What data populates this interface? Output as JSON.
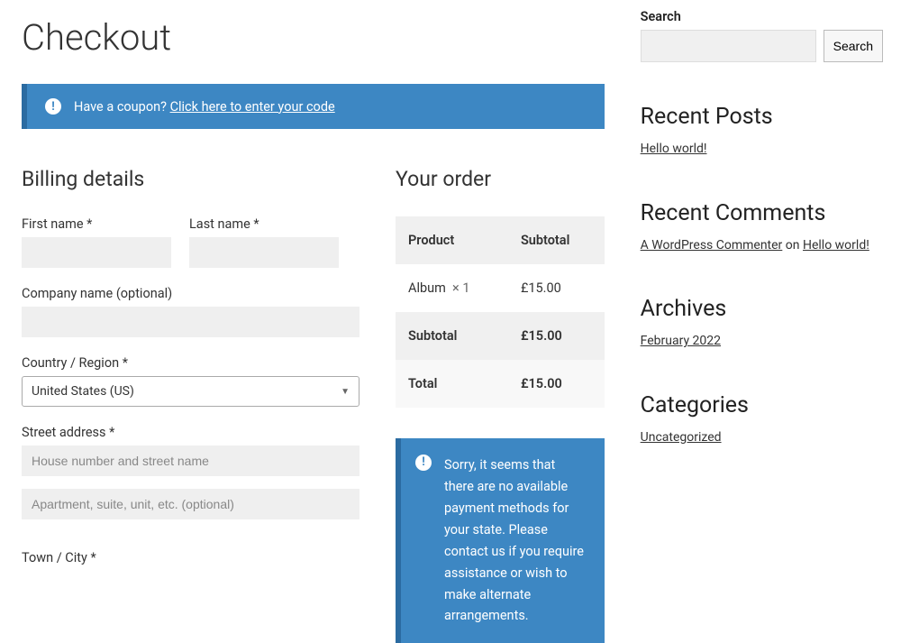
{
  "page": {
    "title": "Checkout"
  },
  "coupon_notice": {
    "text": "Have a coupon? ",
    "link": "Click here to enter your code"
  },
  "billing": {
    "heading": "Billing details",
    "first_name": {
      "label": "First name *",
      "value": ""
    },
    "last_name": {
      "label": "Last name *",
      "value": ""
    },
    "company": {
      "label": "Company name (optional)",
      "value": ""
    },
    "country": {
      "label": "Country / Region *",
      "selected": "United States (US)"
    },
    "street": {
      "label": "Street address *",
      "line1_placeholder": "House number and street name",
      "line2_placeholder": "Apartment, suite, unit, etc. (optional)"
    },
    "town": {
      "label": "Town / City *",
      "value": ""
    }
  },
  "order": {
    "heading": "Your order",
    "columns": {
      "product": "Product",
      "subtotal": "Subtotal"
    },
    "items": [
      {
        "name": "Album",
        "qty": "× 1",
        "subtotal": "£15.00"
      }
    ],
    "subtotal": {
      "label": "Subtotal",
      "value": "£15.00"
    },
    "total": {
      "label": "Total",
      "value": "£15.00"
    },
    "payment_error": "Sorry, it seems that there are no available payment methods for your state. Please contact us if you require assistance or wish to make alternate arrangements."
  },
  "sidebar": {
    "search": {
      "label": "Search",
      "button": "Search"
    },
    "recent_posts": {
      "heading": "Recent Posts",
      "items": [
        "Hello world!"
      ]
    },
    "recent_comments": {
      "heading": "Recent Comments",
      "items": [
        {
          "author": "A WordPress Commenter",
          "on": " on ",
          "post": "Hello world!"
        }
      ]
    },
    "archives": {
      "heading": "Archives",
      "items": [
        "February 2022"
      ]
    },
    "categories": {
      "heading": "Categories",
      "items": [
        "Uncategorized"
      ]
    }
  }
}
